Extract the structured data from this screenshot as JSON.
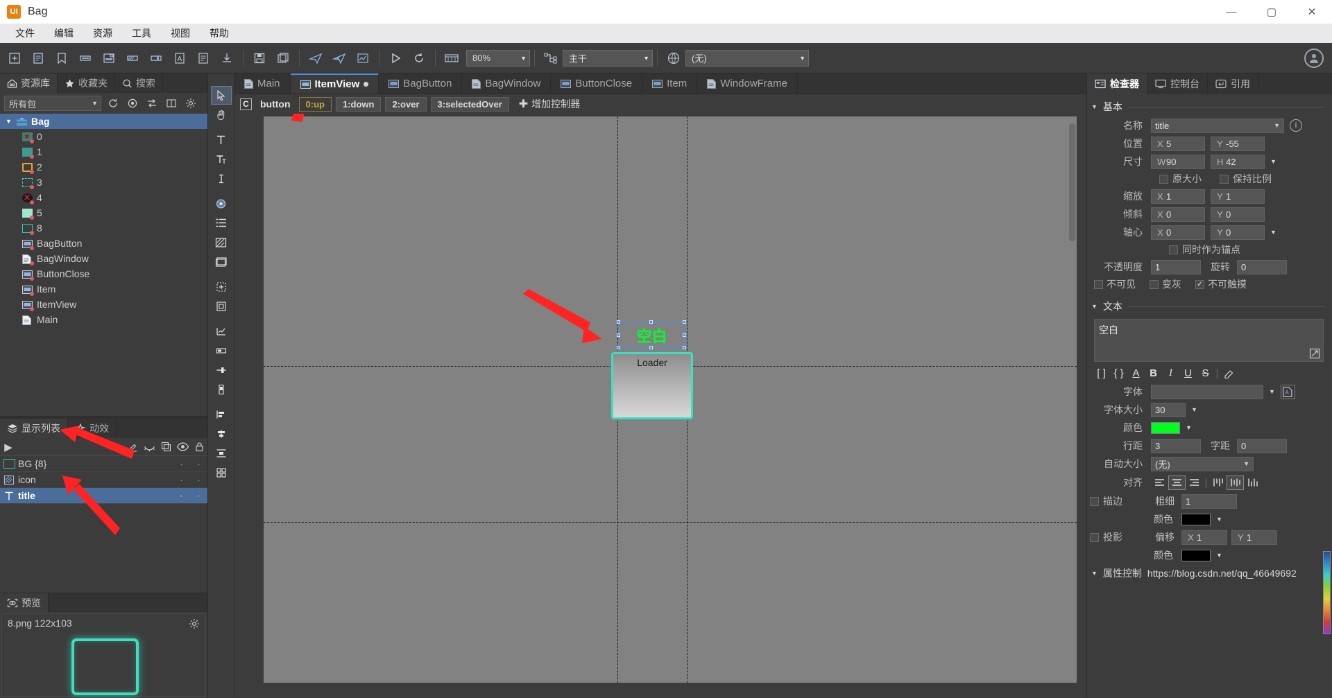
{
  "window": {
    "app_icon": "UI",
    "title": "Bag",
    "minimize": "—",
    "maximize": "▢",
    "close": "✕"
  },
  "menubar": {
    "items": [
      "文件",
      "编辑",
      "资源",
      "工具",
      "视图",
      "帮助"
    ]
  },
  "toolbar": {
    "icons": [
      "new-package-icon",
      "new-component-icon",
      "bookmark-icon",
      "new-button-icon",
      "new-label-icon",
      "new-progressbar-icon",
      "new-slider-icon",
      "new-textfield-icon",
      "new-richtext-icon",
      "import-icon",
      "save-icon",
      "save-all-icon",
      "publish-icon",
      "publish-settings-icon",
      "publish-preview-icon",
      "play-icon",
      "refresh-icon",
      "timeline-icon"
    ],
    "zoom_value": "80%",
    "branch_icon": "branch-icon",
    "branch_value": "主干",
    "globe_icon": "globe-icon",
    "locale_value": "(无)",
    "account_icon": "account-icon"
  },
  "library": {
    "tabs": [
      {
        "label": "资源库",
        "icon": "library-icon",
        "active": true
      },
      {
        "label": "收藏夹",
        "icon": "star-icon",
        "active": false
      },
      {
        "label": "搜索",
        "icon": "search-icon",
        "active": false
      }
    ],
    "filter_value": "所有包",
    "filter_icons": [
      "refresh-icon",
      "locate-icon",
      "sort-icon",
      "columns-icon",
      "settings-icon"
    ],
    "tree": [
      {
        "label": "Bag",
        "type": "package",
        "depth": 0,
        "selected": true,
        "expanded": true
      },
      {
        "label": "0",
        "type": "image-sprite",
        "depth": 1,
        "selected": false
      },
      {
        "label": "1",
        "type": "image-teal",
        "depth": 1,
        "selected": false
      },
      {
        "label": "2",
        "type": "image-orange-frame",
        "depth": 1,
        "selected": false
      },
      {
        "label": "3",
        "type": "image-teal-dashed",
        "depth": 1,
        "selected": false
      },
      {
        "label": "4",
        "type": "image-close",
        "depth": 1,
        "selected": false
      },
      {
        "label": "5",
        "type": "image-mint",
        "depth": 1,
        "selected": false
      },
      {
        "label": "8",
        "type": "image-teal-frame",
        "depth": 1,
        "selected": false
      },
      {
        "label": "BagButton",
        "type": "component-button",
        "depth": 1,
        "selected": false
      },
      {
        "label": "BagWindow",
        "type": "component-doc",
        "depth": 1,
        "selected": false
      },
      {
        "label": "ButtonClose",
        "type": "component-button",
        "depth": 1,
        "selected": false
      },
      {
        "label": "Item",
        "type": "component-button",
        "depth": 1,
        "selected": false
      },
      {
        "label": "ItemView",
        "type": "component-button",
        "depth": 1,
        "selected": false
      },
      {
        "label": "Main",
        "type": "component-doc",
        "depth": 1,
        "selected": false
      }
    ]
  },
  "display_list": {
    "tabs": [
      {
        "label": "显示列表",
        "icon": "layers-icon",
        "active": true
      },
      {
        "label": "动效",
        "icon": "sparkle-icon",
        "active": false
      }
    ],
    "tools": [
      "expand-icon",
      "pen-icon",
      "hide-icon",
      "duplicate-icon",
      "eye-icon",
      "lock-icon"
    ],
    "rows": [
      {
        "name": "BG {8}",
        "icon": "image-teal-frame-icon",
        "col1": "·",
        "col2": "·",
        "selected": false
      },
      {
        "name": "icon",
        "icon": "loader-icon",
        "col1": "·",
        "col2": "·",
        "selected": false
      },
      {
        "name": "title",
        "icon": "text-icon",
        "col1": "·",
        "col2": "·",
        "selected": true
      }
    ]
  },
  "preview": {
    "tab_label": "预览",
    "tab_icon": "preview-icon",
    "file_label": "8.png  122x103",
    "shape_color": "#3ae0c0"
  },
  "tool_strip": {
    "icons": [
      "pointer-icon",
      "hand-icon",
      "text-icon",
      "richtext-icon",
      "input-icon",
      "button-icon",
      "list-icon",
      "loader-icon",
      "movieclip-icon",
      "group-icon",
      "component-icon",
      "graph-icon",
      "progressbar-icon",
      "slider-icon",
      "scrollbar-icon",
      "combobox-icon",
      "tree-icon",
      "align-left-icon",
      "align-center-icon",
      "distribute-icon",
      "grid-icon"
    ],
    "active_index": 0
  },
  "document_tabs": [
    {
      "label": "Main",
      "icon": "component-doc-icon",
      "active": false,
      "modified": false
    },
    {
      "label": "ItemView",
      "icon": "component-button-icon",
      "active": true,
      "modified": true
    },
    {
      "label": "BagButton",
      "icon": "component-button-icon",
      "active": false,
      "modified": false
    },
    {
      "label": "BagWindow",
      "icon": "component-doc-icon",
      "active": false,
      "modified": false
    },
    {
      "label": "ButtonClose",
      "icon": "component-button-icon",
      "active": false,
      "modified": false
    },
    {
      "label": "Item",
      "icon": "component-button-icon",
      "active": false,
      "modified": false
    },
    {
      "label": "WindowFrame",
      "icon": "component-doc-icon",
      "active": false,
      "modified": false
    }
  ],
  "controller_bar": {
    "badge": "C",
    "name": "button",
    "states": [
      {
        "label": "0:up",
        "active": true
      },
      {
        "label": "1:down",
        "active": false
      },
      {
        "label": "2:over",
        "active": false
      },
      {
        "label": "3:selectedOver",
        "active": false
      }
    ],
    "add_label": "增加控制器",
    "add_icon": "plus-icon"
  },
  "canvas": {
    "selected_text": "空白",
    "selected_text_color": "#00ff2a",
    "loader_label": "Loader",
    "loader_border": "#3ae0c0"
  },
  "inspector": {
    "tabs": [
      {
        "label": "检查器",
        "icon": "inspector-icon",
        "active": true
      },
      {
        "label": "控制台",
        "icon": "console-icon",
        "active": false
      },
      {
        "label": "引用",
        "icon": "reference-icon",
        "active": false
      }
    ],
    "basic": {
      "section": "基本",
      "name_label": "名称",
      "name_value": "title",
      "info_icon": "info-icon",
      "pos_label": "位置",
      "pos_x": "5",
      "pos_y": "-55",
      "size_label": "尺寸",
      "size_w": "90",
      "size_h": "42",
      "orig_size_label": "原大小",
      "orig_size_checked": false,
      "keep_ratio_label": "保持比例",
      "keep_ratio_checked": false,
      "scale_label": "缩放",
      "scale_x": "1",
      "scale_y": "1",
      "skew_label": "倾斜",
      "skew_x": "0",
      "skew_y": "0",
      "pivot_label": "轴心",
      "pivot_x": "0",
      "pivot_y": "0",
      "anchor_label": "同时作为锚点",
      "anchor_checked": false,
      "alpha_label": "不透明度",
      "alpha_value": "1",
      "rotation_label": "旋转",
      "rotation_value": "0",
      "invisible_label": "不可见",
      "invisible_checked": false,
      "grayed_label": "变灰",
      "grayed_checked": false,
      "untouchable_label": "不可触摸",
      "untouchable_checked": true
    },
    "text": {
      "section": "文本",
      "value": "空白",
      "edit_icon": "external-edit-icon",
      "format_buttons": [
        "var-brackets-icon",
        "ubb-braces-icon",
        "font-A-icon",
        "bold-icon",
        "italic-icon",
        "underline-icon",
        "strikethrough-icon",
        "clear-format-icon"
      ],
      "font_label": "字体",
      "font_value": "",
      "font_picker_icon": "font-file-icon",
      "fontsize_label": "字体大小",
      "fontsize_value": "30",
      "color_label": "颜色",
      "color_value": "#00ff1e",
      "leading_label": "行距",
      "leading_value": "3",
      "letterspacing_label": "字距",
      "letterspacing_value": "0",
      "autosize_label": "自动大小",
      "autosize_value": "(无)",
      "align_label": "对齐",
      "halign_options": [
        "align-left-icon",
        "align-center-icon",
        "align-right-icon"
      ],
      "halign_active": 1,
      "valign_options": [
        "valign-top-icon",
        "valign-middle-icon",
        "valign-bottom-icon"
      ],
      "valign_active": 1,
      "stroke_label": "描边",
      "stroke_checked": false,
      "stroke_width_label": "粗细",
      "stroke_width_value": "1",
      "stroke_color_label": "颜色",
      "stroke_color_value": "#000000",
      "shadow_label": "投影",
      "shadow_checked": false,
      "shadow_offset_label": "偏移",
      "shadow_x": "1",
      "shadow_y": "1",
      "shadow_color_label": "颜色",
      "shadow_color_value": "#000000"
    },
    "footer": {
      "section": "属性控制",
      "watermark": "https://blog.csdn.net/qq_46649692"
    }
  }
}
